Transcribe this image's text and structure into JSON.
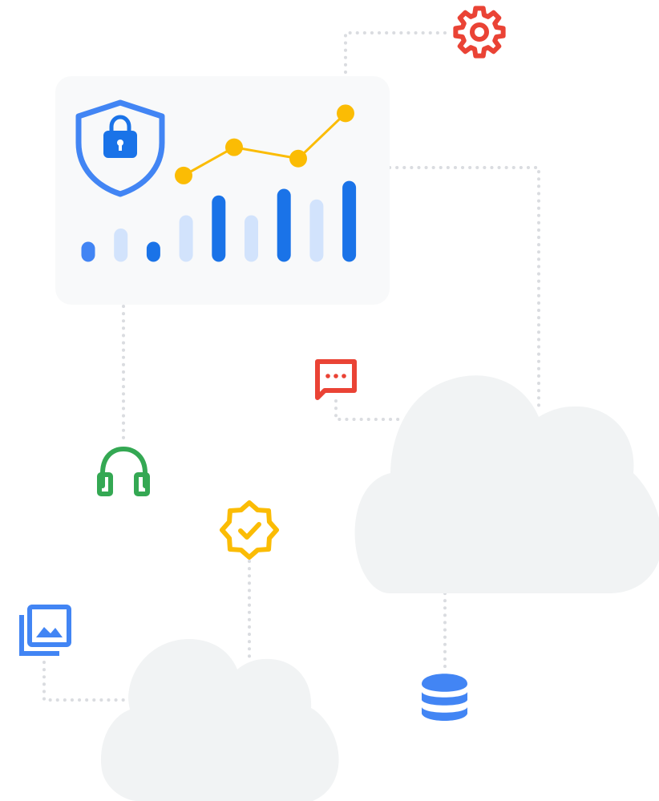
{
  "colors": {
    "blue": "#4285f4",
    "blue_dark": "#1a73e8",
    "blue_light": "#d2e3fc",
    "red": "#ea4335",
    "yellow": "#fbbc04",
    "green": "#34a853",
    "cloud": "#f1f3f4",
    "panel": "#f8f9fa",
    "connector": "#dadce0"
  },
  "panel": {
    "icon": "shield-lock-icon",
    "chart_data": {
      "type": "bar",
      "bars": [
        {
          "value": 1,
          "tone": "blue"
        },
        {
          "value": 2,
          "tone": "light"
        },
        {
          "value": 1,
          "tone": "dark"
        },
        {
          "value": 3,
          "tone": "light"
        },
        {
          "value": 4.5,
          "tone": "dark"
        },
        {
          "value": 3,
          "tone": "light"
        },
        {
          "value": 5,
          "tone": "dark"
        },
        {
          "value": 4.2,
          "tone": "light"
        },
        {
          "value": 5.6,
          "tone": "dark"
        }
      ],
      "trend_line": [
        1,
        3.5,
        2.5,
        6.5
      ],
      "ylim": [
        0,
        6
      ]
    }
  },
  "icons": {
    "gear": "gear-icon",
    "chat": "chat-bubble-icon",
    "headset": "headset-icon",
    "badge": "verified-badge-icon",
    "images": "image-library-icon",
    "database": "database-icon"
  }
}
